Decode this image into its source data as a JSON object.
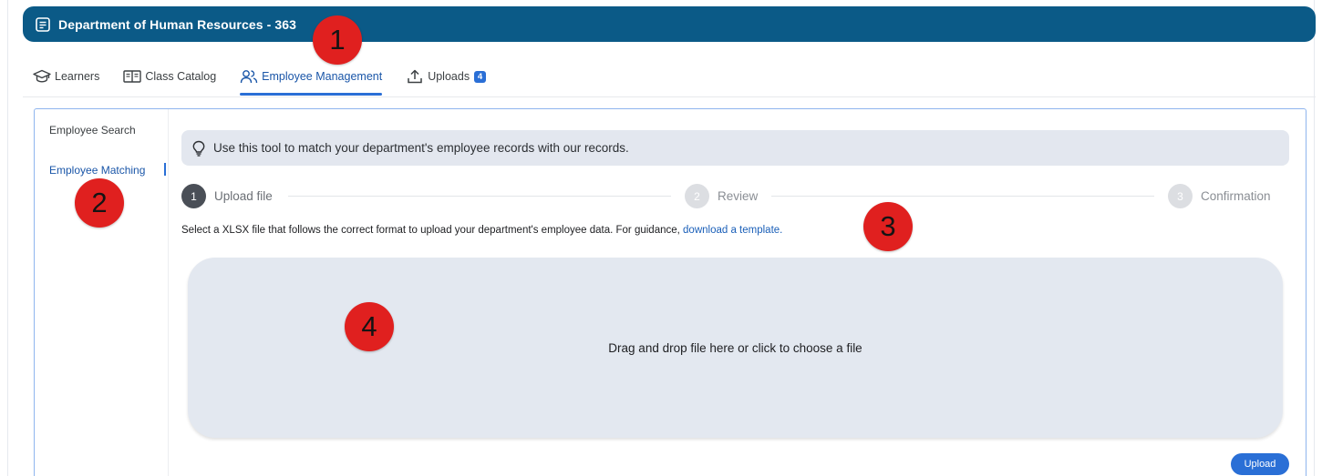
{
  "header": {
    "title": "Department of Human Resources - 363",
    "icon": "document-icon"
  },
  "tabs": [
    {
      "label": "Learners",
      "icon": "graduation-cap-icon"
    },
    {
      "label": "Class Catalog",
      "icon": "open-book-icon"
    },
    {
      "label": "Employee Management",
      "icon": "people-icon",
      "active": true
    },
    {
      "label": "Uploads",
      "icon": "upload-icon",
      "badge": "4"
    }
  ],
  "sidenav": {
    "items": [
      {
        "label": "Employee Search"
      },
      {
        "label": "Employee Matching",
        "active": true
      }
    ]
  },
  "tip": {
    "text": "Use this tool to match your department's employee records with our records.",
    "icon": "lightbulb-icon"
  },
  "stepper": {
    "steps": [
      {
        "number": "1",
        "label": "Upload file",
        "state": "current"
      },
      {
        "number": "2",
        "label": "Review",
        "state": "upcoming"
      },
      {
        "number": "3",
        "label": "Confirmation",
        "state": "upcoming"
      }
    ]
  },
  "instruction": {
    "text": "Select a XLSX file that follows the correct format to upload your department's employee data. For guidance, ",
    "link_text": "download a template."
  },
  "dropzone": {
    "text": "Drag and drop file here or click to choose a file"
  },
  "upload_button": {
    "label": "Upload"
  },
  "markers": [
    "1",
    "2",
    "3",
    "4"
  ],
  "colors": {
    "header": "#0b5a87",
    "accent": "#2a6fd6",
    "link": "#1a5fb8",
    "marker": "#e0201f",
    "dropzone": "#e3e8f0"
  }
}
